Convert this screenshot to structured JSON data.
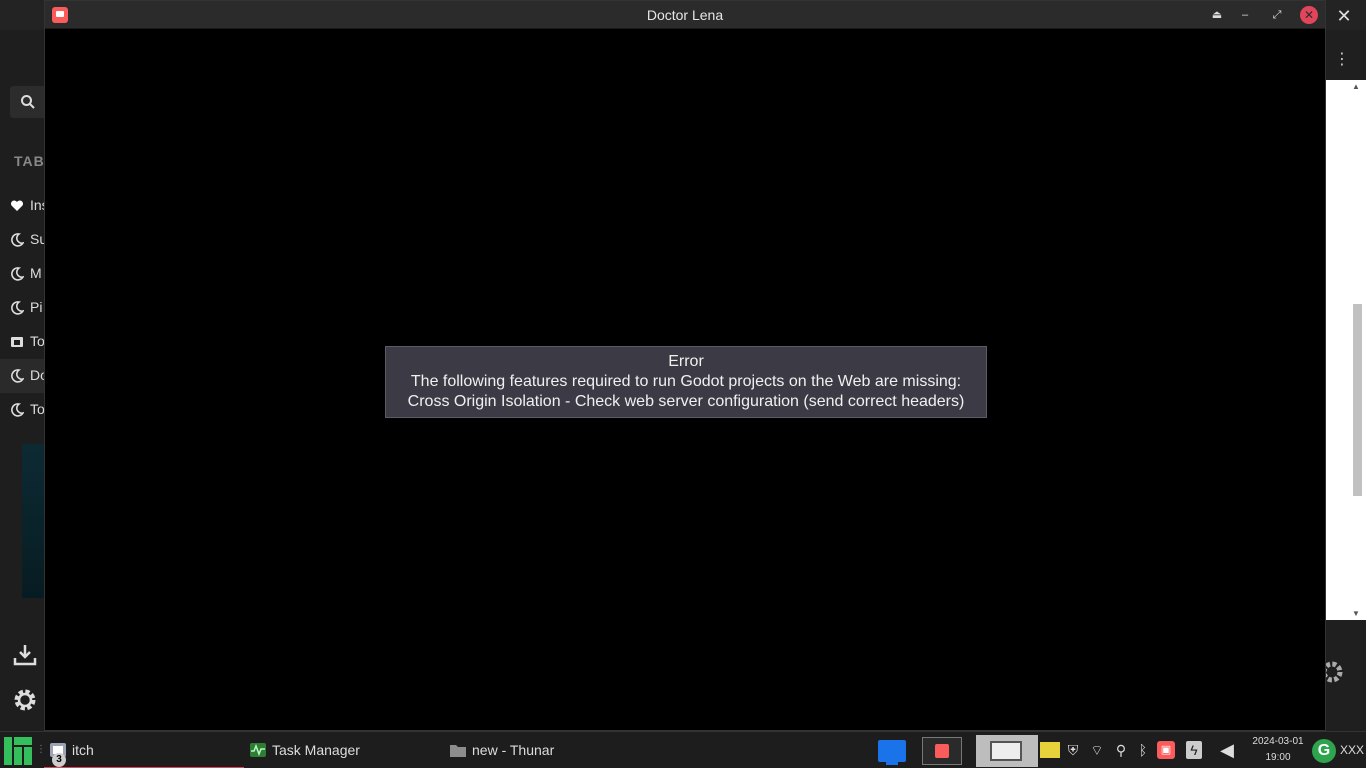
{
  "window": {
    "title": "Doctor Lena",
    "buttons": {
      "shade": "⏏",
      "minimize": "–",
      "maximize": "⤢",
      "close": "✕"
    }
  },
  "error": {
    "title": "Error",
    "line1": "The following features required to run Godot projects on the Web are missing:",
    "line2": "Cross Origin Isolation - Check web server configuration (send correct headers)"
  },
  "background_app": {
    "close_glyph": "✕",
    "kebab_glyph": "⋮",
    "tabs_heading": "TABS",
    "items": [
      {
        "label": "Ins",
        "icon": "heart-icon"
      },
      {
        "label": "Su",
        "icon": "moon-icon"
      },
      {
        "label": "M",
        "icon": "moon-icon"
      },
      {
        "label": "Pi",
        "icon": "moon-icon"
      },
      {
        "label": "To",
        "icon": "window-icon"
      },
      {
        "label": "Do",
        "icon": "moon-icon"
      },
      {
        "label": "To",
        "icon": "moon-icon"
      }
    ]
  },
  "taskbar": {
    "grip": "⋮",
    "tasks": [
      {
        "label": "itch",
        "badge": "3"
      },
      {
        "label": "Task Manager"
      },
      {
        "label": "new - Thunar"
      }
    ],
    "clock": {
      "date": "2024-03-01",
      "time": "19:00"
    },
    "user": "XXX",
    "g_label": "G"
  },
  "colors": {
    "accent": "#e0455b",
    "itch": "#fa5c5c",
    "error_bg": "#3c3b45"
  }
}
